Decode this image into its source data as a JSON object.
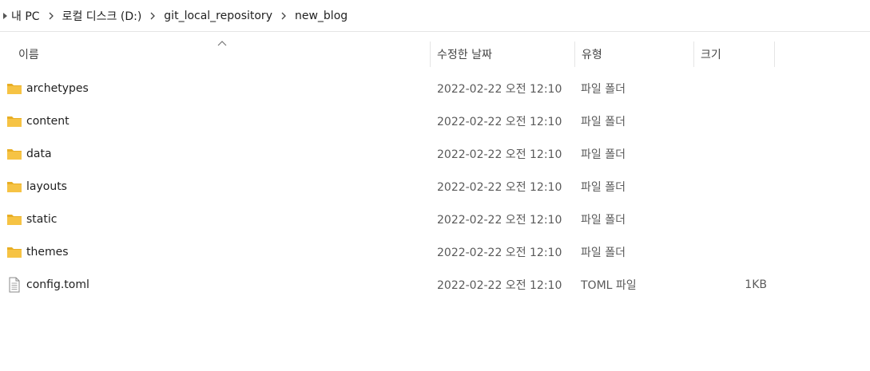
{
  "breadcrumb": {
    "items": [
      "내 PC",
      "로컬 디스크 (D:)",
      "git_local_repository",
      "new_blog"
    ]
  },
  "columns": {
    "name": "이름",
    "date": "수정한 날짜",
    "type": "유형",
    "size": "크기"
  },
  "files": [
    {
      "name": "archetypes",
      "date": "2022-02-22 오전 12:10",
      "type": "파일 폴더",
      "size": "",
      "icon": "folder-icon"
    },
    {
      "name": "content",
      "date": "2022-02-22 오전 12:10",
      "type": "파일 폴더",
      "size": "",
      "icon": "folder-icon"
    },
    {
      "name": "data",
      "date": "2022-02-22 오전 12:10",
      "type": "파일 폴더",
      "size": "",
      "icon": "folder-icon"
    },
    {
      "name": "layouts",
      "date": "2022-02-22 오전 12:10",
      "type": "파일 폴더",
      "size": "",
      "icon": "folder-icon"
    },
    {
      "name": "static",
      "date": "2022-02-22 오전 12:10",
      "type": "파일 폴더",
      "size": "",
      "icon": "folder-icon"
    },
    {
      "name": "themes",
      "date": "2022-02-22 오전 12:10",
      "type": "파일 폴더",
      "size": "",
      "icon": "folder-icon"
    },
    {
      "name": "config.toml",
      "date": "2022-02-22 오전 12:10",
      "type": "TOML 파일",
      "size": "1KB",
      "icon": "file-icon"
    }
  ],
  "colors": {
    "folder": "#F6C344",
    "folder_dark": "#E8AE24",
    "divider": "#e5e5e5"
  }
}
